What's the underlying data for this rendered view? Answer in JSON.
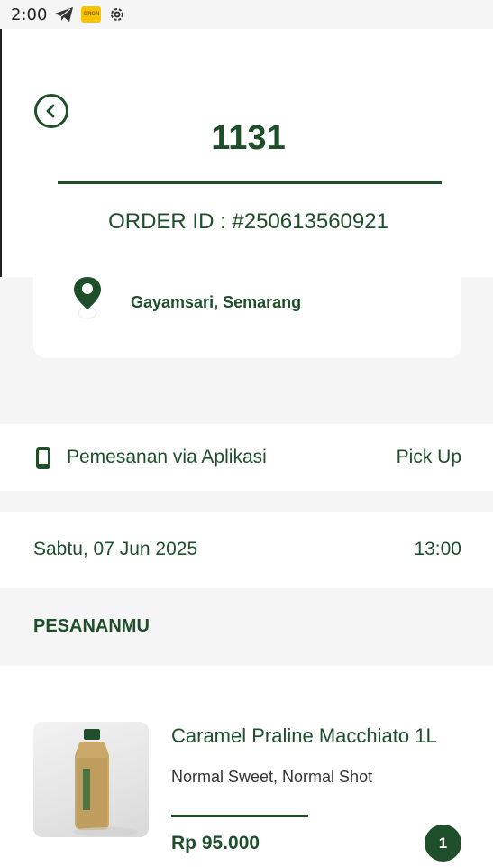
{
  "status_bar": {
    "time": "2:00",
    "icons": [
      "telegram-icon",
      "app-badge-icon",
      "settings-gear-icon"
    ],
    "app_badge_text": "GRGN"
  },
  "header": {
    "title": "1131",
    "order_id": "ORDER ID : #250613560921",
    "back_icon": "chevron-left-circle-icon"
  },
  "location": {
    "icon": "map-pin-icon",
    "name": "Gayamsari, Semarang"
  },
  "order_type": {
    "icon": "smartphone-icon",
    "label": "Pemesanan via Aplikasi",
    "method": "Pick Up"
  },
  "schedule": {
    "date": "Sabtu, 07 Jun 2025",
    "time": "13:00"
  },
  "section": {
    "title": "PESANANMU"
  },
  "items": [
    {
      "name": "Caramel Praline Macchiato 1L",
      "options": "Normal Sweet, Normal Shot",
      "price": "Rp 95.000",
      "quantity": "1"
    }
  ],
  "colors": {
    "primary": "#1f4f2a",
    "background": "#f5f5f5",
    "card": "#ffffff"
  }
}
